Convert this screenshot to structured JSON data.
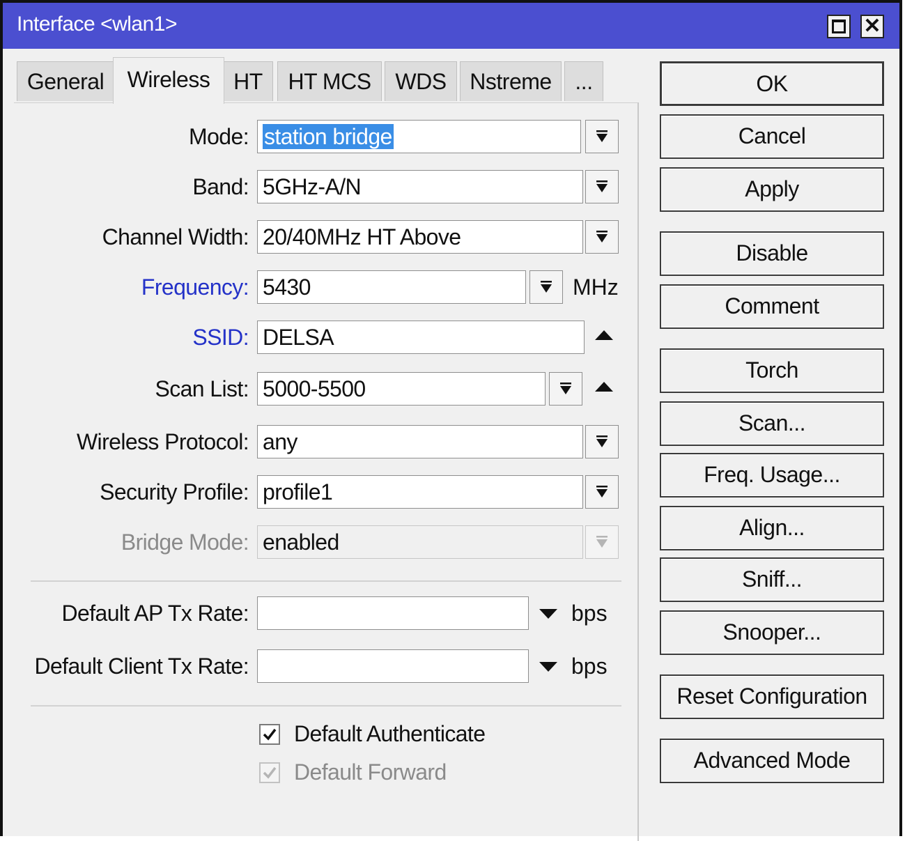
{
  "window": {
    "title": "Interface <wlan1>"
  },
  "tabs": [
    {
      "label": "General"
    },
    {
      "label": "Wireless"
    },
    {
      "label": "HT"
    },
    {
      "label": "HT MCS"
    },
    {
      "label": "WDS"
    },
    {
      "label": "Nstreme"
    },
    {
      "label": "..."
    }
  ],
  "fields": {
    "mode": {
      "label": "Mode:",
      "value": "station bridge"
    },
    "band": {
      "label": "Band:",
      "value": "5GHz-A/N"
    },
    "channel_width": {
      "label": "Channel Width:",
      "value": "20/40MHz HT Above"
    },
    "frequency": {
      "label": "Frequency:",
      "value": "5430",
      "unit": "MHz"
    },
    "ssid": {
      "label": "SSID:",
      "value": "DELSA"
    },
    "scan_list": {
      "label": "Scan List:",
      "value": "5000-5500"
    },
    "wireless_protocol": {
      "label": "Wireless Protocol:",
      "value": "any"
    },
    "security_profile": {
      "label": "Security Profile:",
      "value": "profile1"
    },
    "bridge_mode": {
      "label": "Bridge Mode:",
      "value": "enabled"
    },
    "default_ap_tx_rate": {
      "label": "Default AP Tx Rate:",
      "value": "",
      "unit": "bps"
    },
    "default_client_tx_rate": {
      "label": "Default Client Tx Rate:",
      "value": "",
      "unit": "bps"
    }
  },
  "checkboxes": {
    "default_authenticate": {
      "label": "Default Authenticate",
      "checked": true
    },
    "default_forward": {
      "label": "Default Forward",
      "checked": true,
      "disabled": true
    }
  },
  "buttons": {
    "ok": "OK",
    "cancel": "Cancel",
    "apply": "Apply",
    "disable": "Disable",
    "comment": "Comment",
    "torch": "Torch",
    "scan": "Scan...",
    "freq_usage": "Freq. Usage...",
    "align": "Align...",
    "sniff": "Sniff...",
    "snooper": "Snooper...",
    "reset_configuration": "Reset Configuration",
    "advanced_mode": "Advanced Mode"
  },
  "colors": {
    "titlebar": "#4b4fd0",
    "label_blue": "#2432c8",
    "selection": "#3a8ee6",
    "disabled_text": "#8a8a8a"
  }
}
